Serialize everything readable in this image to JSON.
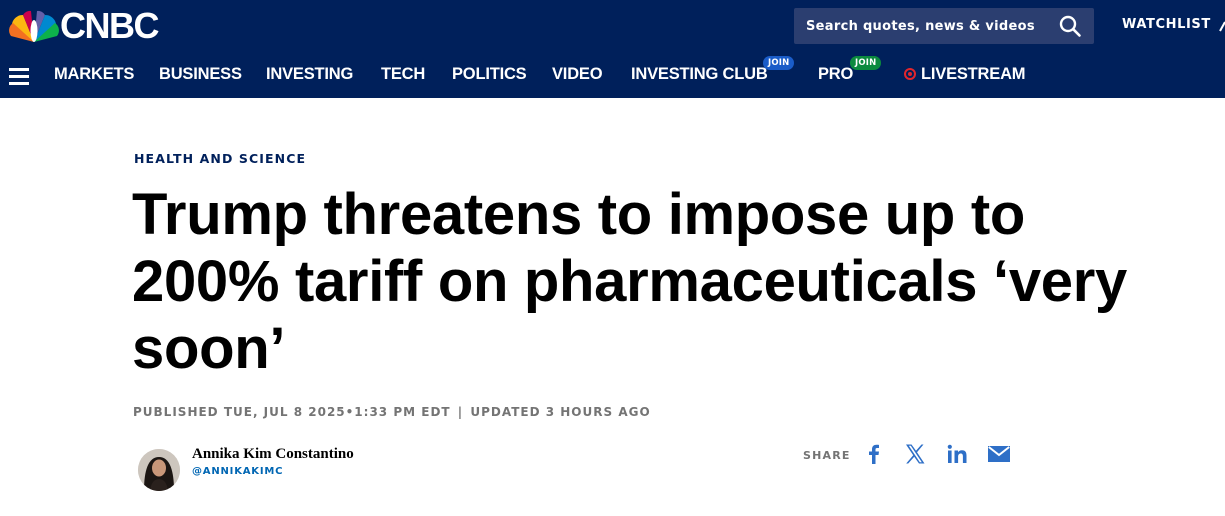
{
  "brand": {
    "logo_text": "CNBC",
    "logo_icon": "peacock-logo-icon",
    "colors": {
      "header_bg": "#00205b",
      "search_bg": "#2b3e70",
      "link": "#0066b3",
      "live": "#e1262d"
    }
  },
  "header": {
    "search_placeholder": "Search quotes, news & videos",
    "search_icon": "search-icon",
    "watchlist_label": "WATCHLIST"
  },
  "nav": {
    "menu_icon": "hamburger-menu-icon",
    "items": [
      {
        "label": "MARKETS"
      },
      {
        "label": "BUSINESS"
      },
      {
        "label": "INVESTING"
      },
      {
        "label": "TECH"
      },
      {
        "label": "POLITICS"
      },
      {
        "label": "VIDEO"
      },
      {
        "label": "INVESTING CLUB",
        "badge": "JOIN"
      },
      {
        "label": "PRO",
        "badge": "JOIN"
      },
      {
        "label": "LIVESTREAM"
      }
    ]
  },
  "article": {
    "section": "HEALTH AND SCIENCE",
    "headline_lines": [
      "Trump threatens to impose up to",
      "200% tariff on pharmaceuticals ‘very",
      "soon’"
    ],
    "published": "PUBLISHED TUE, JUL 8 2025•1:33 PM EDT",
    "separator": "|",
    "updated": "UPDATED 3 HOURS AGO",
    "author": {
      "name": "Annika Kim Constantino",
      "handle": "@ANNIKAKIMC"
    },
    "share": {
      "label": "SHARE",
      "icons": [
        "facebook-icon",
        "x-icon",
        "linkedin-icon",
        "email-icon"
      ]
    }
  }
}
